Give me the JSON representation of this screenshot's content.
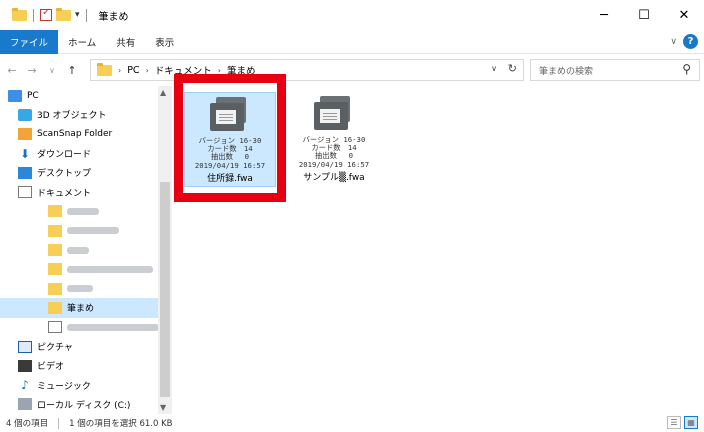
{
  "window": {
    "title": "筆まめ",
    "minimize": "─",
    "maximize": "☐",
    "close": "✕"
  },
  "ribbon": {
    "tabs": [
      "ファイル",
      "ホーム",
      "共有",
      "表示"
    ],
    "expand": "∨",
    "help": "?"
  },
  "address": {
    "crumbs": [
      "PC",
      "ドキュメント",
      "筆まめ"
    ],
    "dropdown": "∨",
    "refresh": "↻"
  },
  "search": {
    "placeholder": "筆まめの検索",
    "icon": "⚲"
  },
  "nav": {
    "items": [
      {
        "label": "PC",
        "icon": "pc-icon"
      },
      {
        "label": "3D オブジェクト",
        "icon": "cube-icon"
      },
      {
        "label": "ScanSnap Folder",
        "icon": "scansnap-folder-icon"
      },
      {
        "label": "ダウンロード",
        "icon": "download-icon"
      },
      {
        "label": "デスクトップ",
        "icon": "desktop-icon"
      },
      {
        "label": "ドキュメント",
        "icon": "documents-icon"
      },
      {
        "label": "",
        "icon": "folder-icon"
      },
      {
        "label": "",
        "icon": "folder-icon"
      },
      {
        "label": "",
        "icon": "folder-icon"
      },
      {
        "label": "",
        "icon": "folder-icon"
      },
      {
        "label": "",
        "icon": "folder-icon"
      },
      {
        "label": "筆まめ",
        "icon": "folder-icon"
      },
      {
        "label": "",
        "icon": "file-icon"
      },
      {
        "label": "ピクチャ",
        "icon": "pictures-icon"
      },
      {
        "label": "ビデオ",
        "icon": "videos-icon"
      },
      {
        "label": "ミュージック",
        "icon": "music-icon"
      },
      {
        "label": "ローカル ディスク (C:)",
        "icon": "disk-icon"
      }
    ]
  },
  "files": [
    {
      "version": "バージョン 16-30",
      "cards": "カード数　14",
      "extracted": "抽出数　 0",
      "date": "2019/04/19 16:57",
      "name": "住所録.fwa",
      "selected": true
    },
    {
      "version": "バージョン 16-30",
      "cards": "カード数　14",
      "extracted": "抽出数　 0",
      "date": "2019/04/19 16:57",
      "name": "サンプル▒.fwa",
      "selected": false
    }
  ],
  "status": {
    "count": "4 個の項目",
    "selection": "1 個の項目を選択 61.0 KB"
  },
  "colors": {
    "accent": "#1979ca",
    "highlight": "#e60012",
    "selection": "#cce8ff"
  }
}
